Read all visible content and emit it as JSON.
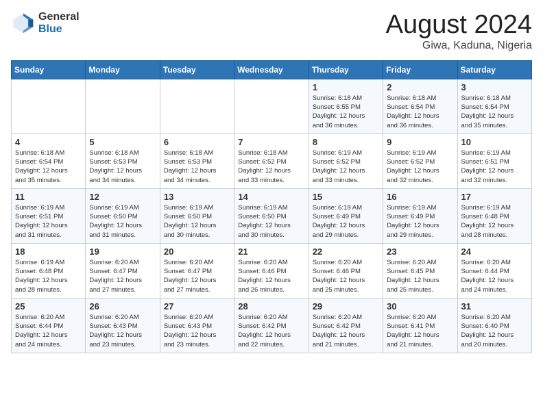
{
  "logo": {
    "general": "General",
    "blue": "Blue"
  },
  "title": "August 2024",
  "location": "Giwa, Kaduna, Nigeria",
  "days_of_week": [
    "Sunday",
    "Monday",
    "Tuesday",
    "Wednesday",
    "Thursday",
    "Friday",
    "Saturday"
  ],
  "weeks": [
    [
      {
        "day": "",
        "info": ""
      },
      {
        "day": "",
        "info": ""
      },
      {
        "day": "",
        "info": ""
      },
      {
        "day": "",
        "info": ""
      },
      {
        "day": "1",
        "info": "Sunrise: 6:18 AM\nSunset: 6:55 PM\nDaylight: 12 hours\nand 36 minutes."
      },
      {
        "day": "2",
        "info": "Sunrise: 6:18 AM\nSunset: 6:54 PM\nDaylight: 12 hours\nand 36 minutes."
      },
      {
        "day": "3",
        "info": "Sunrise: 6:18 AM\nSunset: 6:54 PM\nDaylight: 12 hours\nand 35 minutes."
      }
    ],
    [
      {
        "day": "4",
        "info": "Sunrise: 6:18 AM\nSunset: 6:54 PM\nDaylight: 12 hours\nand 35 minutes."
      },
      {
        "day": "5",
        "info": "Sunrise: 6:18 AM\nSunset: 6:53 PM\nDaylight: 12 hours\nand 34 minutes."
      },
      {
        "day": "6",
        "info": "Sunrise: 6:18 AM\nSunset: 6:53 PM\nDaylight: 12 hours\nand 34 minutes."
      },
      {
        "day": "7",
        "info": "Sunrise: 6:18 AM\nSunset: 6:52 PM\nDaylight: 12 hours\nand 33 minutes."
      },
      {
        "day": "8",
        "info": "Sunrise: 6:19 AM\nSunset: 6:52 PM\nDaylight: 12 hours\nand 33 minutes."
      },
      {
        "day": "9",
        "info": "Sunrise: 6:19 AM\nSunset: 6:52 PM\nDaylight: 12 hours\nand 32 minutes."
      },
      {
        "day": "10",
        "info": "Sunrise: 6:19 AM\nSunset: 6:51 PM\nDaylight: 12 hours\nand 32 minutes."
      }
    ],
    [
      {
        "day": "11",
        "info": "Sunrise: 6:19 AM\nSunset: 6:51 PM\nDaylight: 12 hours\nand 31 minutes."
      },
      {
        "day": "12",
        "info": "Sunrise: 6:19 AM\nSunset: 6:50 PM\nDaylight: 12 hours\nand 31 minutes."
      },
      {
        "day": "13",
        "info": "Sunrise: 6:19 AM\nSunset: 6:50 PM\nDaylight: 12 hours\nand 30 minutes."
      },
      {
        "day": "14",
        "info": "Sunrise: 6:19 AM\nSunset: 6:50 PM\nDaylight: 12 hours\nand 30 minutes."
      },
      {
        "day": "15",
        "info": "Sunrise: 6:19 AM\nSunset: 6:49 PM\nDaylight: 12 hours\nand 29 minutes."
      },
      {
        "day": "16",
        "info": "Sunrise: 6:19 AM\nSunset: 6:49 PM\nDaylight: 12 hours\nand 29 minutes."
      },
      {
        "day": "17",
        "info": "Sunrise: 6:19 AM\nSunset: 6:48 PM\nDaylight: 12 hours\nand 28 minutes."
      }
    ],
    [
      {
        "day": "18",
        "info": "Sunrise: 6:19 AM\nSunset: 6:48 PM\nDaylight: 12 hours\nand 28 minutes."
      },
      {
        "day": "19",
        "info": "Sunrise: 6:20 AM\nSunset: 6:47 PM\nDaylight: 12 hours\nand 27 minutes."
      },
      {
        "day": "20",
        "info": "Sunrise: 6:20 AM\nSunset: 6:47 PM\nDaylight: 12 hours\nand 27 minutes."
      },
      {
        "day": "21",
        "info": "Sunrise: 6:20 AM\nSunset: 6:46 PM\nDaylight: 12 hours\nand 26 minutes."
      },
      {
        "day": "22",
        "info": "Sunrise: 6:20 AM\nSunset: 6:46 PM\nDaylight: 12 hours\nand 25 minutes."
      },
      {
        "day": "23",
        "info": "Sunrise: 6:20 AM\nSunset: 6:45 PM\nDaylight: 12 hours\nand 25 minutes."
      },
      {
        "day": "24",
        "info": "Sunrise: 6:20 AM\nSunset: 6:44 PM\nDaylight: 12 hours\nand 24 minutes."
      }
    ],
    [
      {
        "day": "25",
        "info": "Sunrise: 6:20 AM\nSunset: 6:44 PM\nDaylight: 12 hours\nand 24 minutes."
      },
      {
        "day": "26",
        "info": "Sunrise: 6:20 AM\nSunset: 6:43 PM\nDaylight: 12 hours\nand 23 minutes."
      },
      {
        "day": "27",
        "info": "Sunrise: 6:20 AM\nSunset: 6:43 PM\nDaylight: 12 hours\nand 23 minutes."
      },
      {
        "day": "28",
        "info": "Sunrise: 6:20 AM\nSunset: 6:42 PM\nDaylight: 12 hours\nand 22 minutes."
      },
      {
        "day": "29",
        "info": "Sunrise: 6:20 AM\nSunset: 6:42 PM\nDaylight: 12 hours\nand 21 minutes."
      },
      {
        "day": "30",
        "info": "Sunrise: 6:20 AM\nSunset: 6:41 PM\nDaylight: 12 hours\nand 21 minutes."
      },
      {
        "day": "31",
        "info": "Sunrise: 6:20 AM\nSunset: 6:40 PM\nDaylight: 12 hours\nand 20 minutes."
      }
    ]
  ]
}
